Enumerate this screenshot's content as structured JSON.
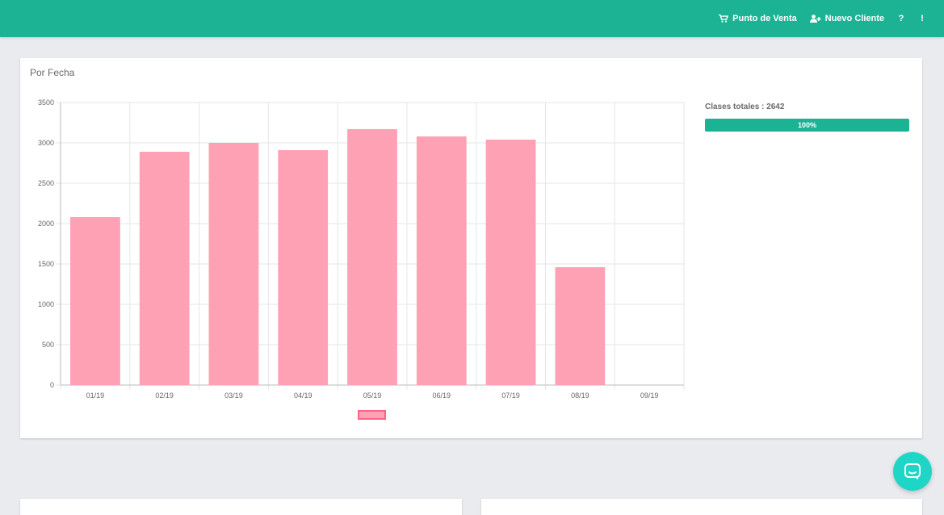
{
  "nav": {
    "pos_label": "Punto de Venta",
    "new_client_label": "Nuevo Cliente",
    "help_label": "?",
    "more_label": "!",
    "pos_icon": "cart-icon",
    "new_client_icon": "user-plus-icon"
  },
  "card": {
    "title": "Por Fecha",
    "stat_label": "Clases totales : 2642",
    "progress_text": "100%",
    "progress_value": 1.0
  },
  "chat": {
    "icon": "chat-bubble-icon"
  },
  "colors": {
    "primary": "#1bb394",
    "bar_fill": "#ffa1b5",
    "bar_border": "#ff6384",
    "chat": "#1fd6c6"
  },
  "chart_data": {
    "type": "bar",
    "categories": [
      "01/19",
      "02/19",
      "03/19",
      "04/19",
      "05/19",
      "06/19",
      "07/19",
      "08/19",
      "09/19"
    ],
    "values": [
      2080,
      2890,
      3000,
      2910,
      3170,
      3080,
      3040,
      1460,
      0
    ],
    "y_ticks": [
      "0",
      "500",
      "1000",
      "1500",
      "2000",
      "2500",
      "3000",
      "3500"
    ],
    "ylim": [
      0,
      3500
    ],
    "grid": true,
    "legend": "bottom-center",
    "title": "",
    "xlabel": "",
    "ylabel": ""
  }
}
